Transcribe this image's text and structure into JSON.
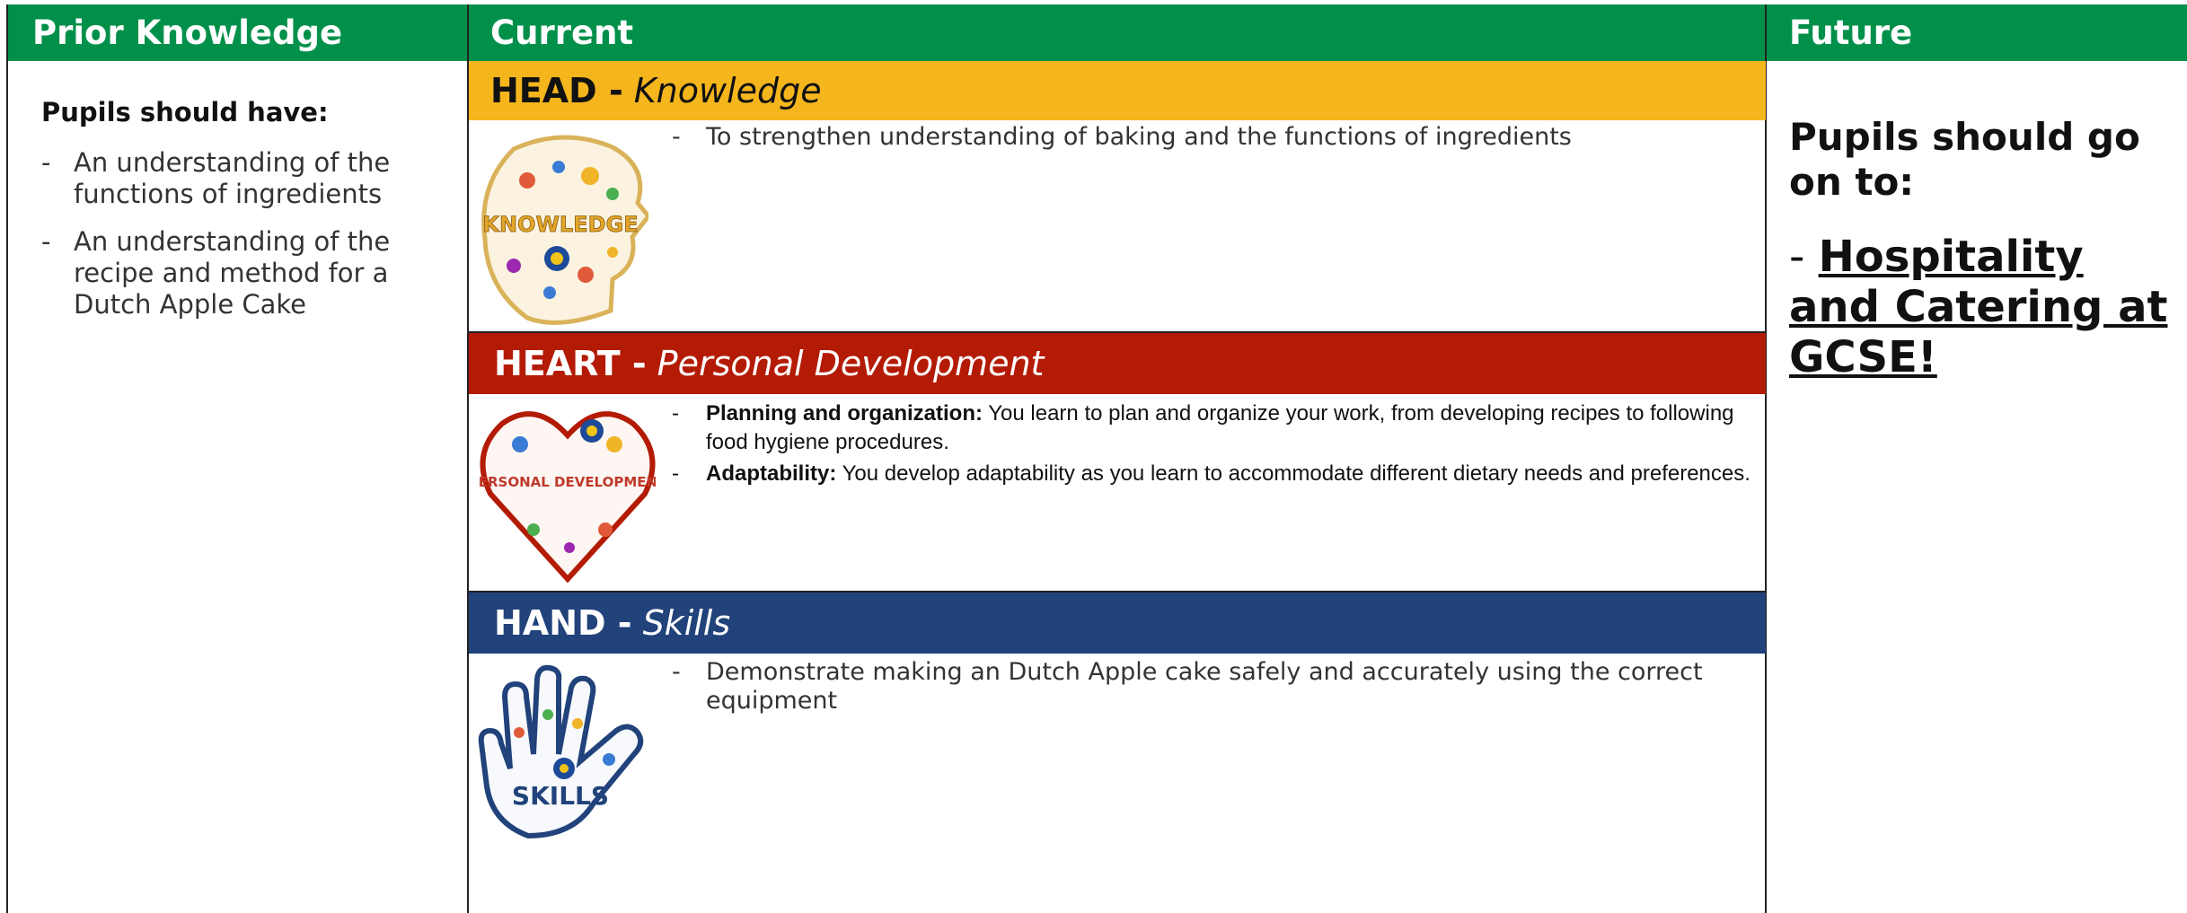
{
  "headers": {
    "prior": "Prior Knowledge",
    "current": "Current",
    "future": "Future"
  },
  "prior": {
    "title": "Pupils should have:",
    "items": [
      "An understanding of the functions of ingredients",
      "An understanding of the recipe and method for a Dutch Apple Cake"
    ]
  },
  "current": {
    "head": {
      "label": "HEAD -",
      "sub": "Knowledge",
      "badge_text": "KNOWLEDGE",
      "items": [
        "To strengthen understanding of baking and the functions of ingredients"
      ]
    },
    "heart": {
      "label": "HEART -",
      "sub": "Personal Development",
      "badge_text": "PERSONAL DEVELOPMENT",
      "items": [
        {
          "bold": "Planning and organization:",
          "text": "You learn to plan and organize your work, from developing recipes to following food hygiene procedures."
        },
        {
          "bold": "Adaptability:",
          "text": "You develop adaptability as you learn to accommodate different dietary needs and preferences."
        }
      ]
    },
    "hand": {
      "label": "HAND -",
      "sub": "Skills",
      "badge_text": "SKILLS",
      "items": [
        "Demonstrate making an Dutch Apple cake safely and accurately using the correct equipment"
      ]
    }
  },
  "future": {
    "lead": "Pupils should go on to:",
    "dash": "-",
    "link": "Hospitality and Catering at GCSE!"
  },
  "colors": {
    "header_green": "#00904a",
    "head_yellow": "#f5b51c",
    "heart_red": "#b31b05",
    "hand_blue": "#21427a"
  },
  "icons": [
    "knowledge-head-icon",
    "personal-development-heart-icon",
    "skills-hand-icon"
  ]
}
